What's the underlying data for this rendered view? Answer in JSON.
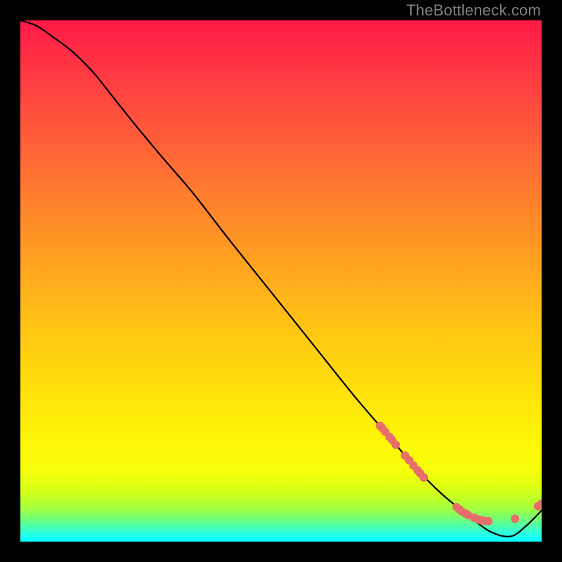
{
  "watermark": {
    "text": "TheBottleneck.com"
  },
  "colors": {
    "curve_stroke": "#000000",
    "marker_fill": "#e76f6b",
    "marker_stroke": "#a23e3e"
  },
  "chart_data": {
    "type": "line",
    "title": "",
    "xlabel": "",
    "ylabel": "",
    "xlim": [
      0,
      100
    ],
    "ylim": [
      0,
      100
    ],
    "grid": false,
    "legend": false,
    "series": [
      {
        "name": "curve",
        "x": [
          0,
          3,
          6,
          10,
          14,
          18,
          22,
          27,
          33,
          40,
          48,
          56,
          64,
          70,
          76,
          81,
          86,
          90,
          94,
          97,
          100
        ],
        "values": [
          100,
          99,
          97,
          94,
          90,
          85,
          80,
          74,
          67,
          58,
          48,
          38,
          28,
          21,
          14,
          9,
          5,
          2,
          1,
          3,
          6
        ]
      }
    ],
    "markers": [
      {
        "x": 69.0,
        "y": 22.2
      },
      {
        "x": 69.4,
        "y": 21.8
      },
      {
        "x": 70.0,
        "y": 21.1
      },
      {
        "x": 70.8,
        "y": 20.1
      },
      {
        "x": 71.3,
        "y": 19.5
      },
      {
        "x": 72.0,
        "y": 18.6
      },
      {
        "x": 73.8,
        "y": 16.5
      },
      {
        "x": 74.6,
        "y": 15.6
      },
      {
        "x": 75.4,
        "y": 14.6
      },
      {
        "x": 76.2,
        "y": 13.7
      },
      {
        "x": 76.7,
        "y": 13.1
      },
      {
        "x": 77.4,
        "y": 12.3
      },
      {
        "x": 83.7,
        "y": 6.6
      },
      {
        "x": 84.2,
        "y": 6.2
      },
      {
        "x": 84.7,
        "y": 5.8
      },
      {
        "x": 85.4,
        "y": 5.4
      },
      {
        "x": 85.9,
        "y": 5.1
      },
      {
        "x": 87.0,
        "y": 4.6
      },
      {
        "x": 87.7,
        "y": 4.3
      },
      {
        "x": 88.4,
        "y": 4.1
      },
      {
        "x": 89.1,
        "y": 4.0
      },
      {
        "x": 89.8,
        "y": 3.9
      },
      {
        "x": 94.9,
        "y": 4.4
      },
      {
        "x": 99.3,
        "y": 6.8
      },
      {
        "x": 100.0,
        "y": 7.3
      }
    ]
  }
}
